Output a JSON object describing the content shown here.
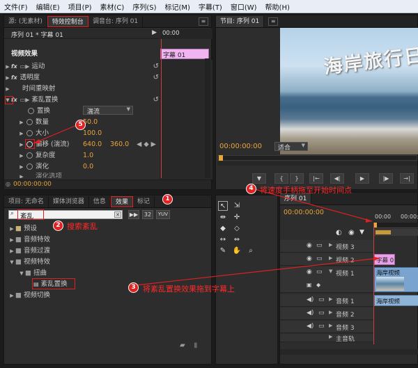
{
  "menu": [
    "文件(F)",
    "编辑(E)",
    "项目(P)",
    "素材(C)",
    "序列(S)",
    "标记(M)",
    "字幕(T)",
    "窗口(W)",
    "帮助(H)"
  ],
  "effect_controls": {
    "tabs": [
      "源: (无素材)",
      "特效控制台",
      "调音台: 序列 01"
    ],
    "sequence_label": "序列 01 * 字幕 01",
    "timecode_header": "00:00",
    "clip_label": "字幕 01",
    "section_video": "视频效果",
    "effects": [
      "运动",
      "透明度",
      "时间重映射",
      "紊乱置换"
    ],
    "params": {
      "displace_label": "置换",
      "displace_value": "湍流",
      "amount_label": "数量",
      "amount_value": "50.0",
      "size_label": "大小",
      "size_value": "100.0",
      "offset_label": "偏移 (湍流)",
      "offset_x": "640.0",
      "offset_y": "360.0",
      "complexity_label": "复杂度",
      "complexity_value": "1.0",
      "evolution_label": "演化",
      "evolution_value": "0.0",
      "evolution_options_label": "演化选项"
    },
    "timecode": "00:00:00:00"
  },
  "program": {
    "tab": "节目: 序列 01",
    "video_text": "海岸旅行日",
    "timecode": "00:00:00:00",
    "fit": "适合"
  },
  "effects_panel": {
    "tabs": [
      "项目: 无命名",
      "媒体浏览器",
      "信息",
      "效果",
      "标记"
    ],
    "search_value": "紊乱",
    "btn_32": "32",
    "btn_yuv": "YUV",
    "tree": [
      "预设",
      "音频特效",
      "音频过渡",
      "视频特效",
      "扭曲",
      "紊乱置换",
      "视频切换"
    ]
  },
  "timeline": {
    "tab": "序列 01",
    "timecode": "00:00:00:00",
    "ruler_start": "00:00",
    "ruler_end": "00:00:1",
    "tracks": [
      "视频 3",
      "视频 2",
      "视频 1",
      "音频 1",
      "音频 2",
      "音频 3",
      "主音轨"
    ],
    "clip_title": "字幕 0",
    "clip_video1": "海岸视频",
    "clip_audio1": "海岸视频"
  },
  "annotations": {
    "a1": "1",
    "a2": "2",
    "a2_text": "搜索紊乱",
    "a3": "3",
    "a3_text": "将紊乱置换效果拖到字幕上",
    "a4": "4",
    "a4_text": "将速度手柄拖至开始时间点",
    "a5": "5"
  }
}
